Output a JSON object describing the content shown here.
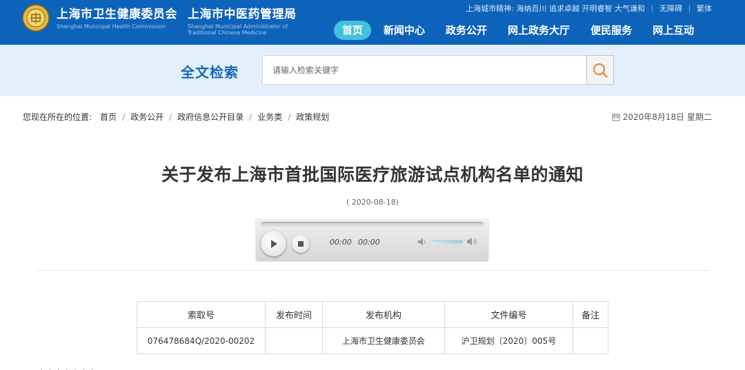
{
  "header": {
    "org1_cn": "上海市卫生健康委员会",
    "org1_en": "Shanghai Municipal Health Commission",
    "org2_cn": "上海市中医药管理局",
    "org2_en": "Shanghai Municipal Administrator of Traditional Chinese Medicine",
    "spirit_text": "上海城市精神: 海纳百川 追求卓越 开明睿智 大气谦和",
    "accessibility_link": "无障碍",
    "traditional_link": "繁体",
    "logo_icon": "health-commission-emblem-icon",
    "nav": [
      {
        "label": "首页",
        "active": true
      },
      {
        "label": "新闻中心"
      },
      {
        "label": "政务公开"
      },
      {
        "label": "网上政务大厅"
      },
      {
        "label": "便民服务"
      },
      {
        "label": "网上互动"
      }
    ],
    "colors": {
      "bar": "#0d63b9",
      "nav_active": "#3fc2dd"
    }
  },
  "search": {
    "title": "全文检索",
    "placeholder": "请输入检索关键字",
    "value": "",
    "button_icon": "search-icon",
    "colors": {
      "band": "#e3f0fb",
      "title": "#1468b8",
      "icon": "#f07a2a"
    }
  },
  "breadcrumb": {
    "label": "您现在所在的位置:",
    "items": [
      "首页",
      "政务公开",
      "政府信息公开目录",
      "业务类",
      "政策规划"
    ],
    "date": "2020年8月18日 星期二",
    "date_icon": "calendar-icon"
  },
  "article": {
    "title": "关于发布上海市首批国际医疗旅游试点机构名单的通知",
    "date": "( 2020-08-18)"
  },
  "player": {
    "current_time": "00:00",
    "duration": "00:00",
    "progress": 0,
    "play_icon": "play-icon",
    "stop_icon": "stop-icon",
    "mute_icon": "volume-low-icon",
    "volume_icon": "volume-high-icon"
  },
  "info_table": {
    "headers": [
      "索取号",
      "发布时间",
      "发布机构",
      "文件编号",
      "备注"
    ],
    "rows": [
      [
        "076478684Q/2020-00202",
        "",
        "上海市卫生健康委员会",
        "沪卫规划〔2020〕005号",
        ""
      ]
    ]
  },
  "cut_text": "· · · · · · ·"
}
